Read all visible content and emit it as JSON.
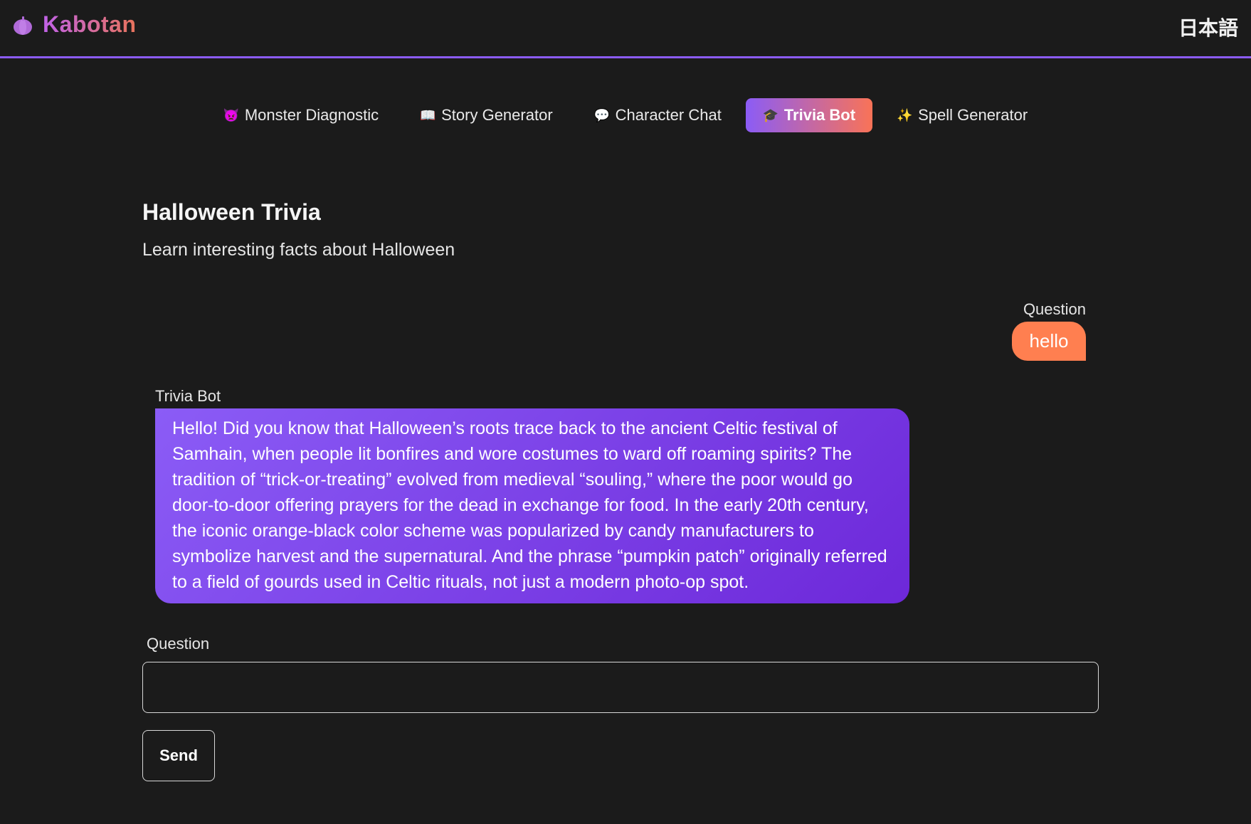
{
  "header": {
    "brand_icon": "pumpkin-icon",
    "brand_name": "Kabotan",
    "language_toggle": "日本語"
  },
  "nav": {
    "items": [
      {
        "icon": "monster-icon",
        "glyph": "👿",
        "label": "Monster Diagnostic",
        "active": false
      },
      {
        "icon": "book-icon",
        "glyph": "📖",
        "label": "Story Generator",
        "active": false
      },
      {
        "icon": "speech-bubble-icon",
        "glyph": "💬",
        "label": "Character Chat",
        "active": false
      },
      {
        "icon": "graduation-cap-icon",
        "glyph": "🎓",
        "label": "Trivia Bot",
        "active": true
      },
      {
        "icon": "sparkles-icon",
        "glyph": "✨",
        "label": "Spell Generator",
        "active": false
      }
    ]
  },
  "main": {
    "title": "Halloween Trivia",
    "subtitle": "Learn interesting facts about Halloween"
  },
  "chat": {
    "user_label": "Question",
    "user_message": "hello",
    "bot_label": "Trivia Bot",
    "bot_message": "Hello! Did you know that Halloween’s roots trace back to the ancient Celtic festival of Samhain, when people lit bonfires and wore costumes to ward off roaming spirits? The tradition of “trick-or-treating” evolved from medieval “souling,” where the poor would go door-to-door offering prayers for the dead in exchange for food. In the early 20th century, the iconic orange-black color scheme was popularized by candy manufacturers to symbolize harvest and the supernatural. And the phrase “pumpkin patch” originally referred to a field of gourds used in Celtic rituals, not just a modern photo-op spot."
  },
  "input": {
    "label": "Question",
    "value": "",
    "placeholder": "",
    "send_label": "Send"
  },
  "colors": {
    "background": "#1b1b1b",
    "accent_purple": "#8b5cf6",
    "accent_orange": "#ff7f50"
  }
}
